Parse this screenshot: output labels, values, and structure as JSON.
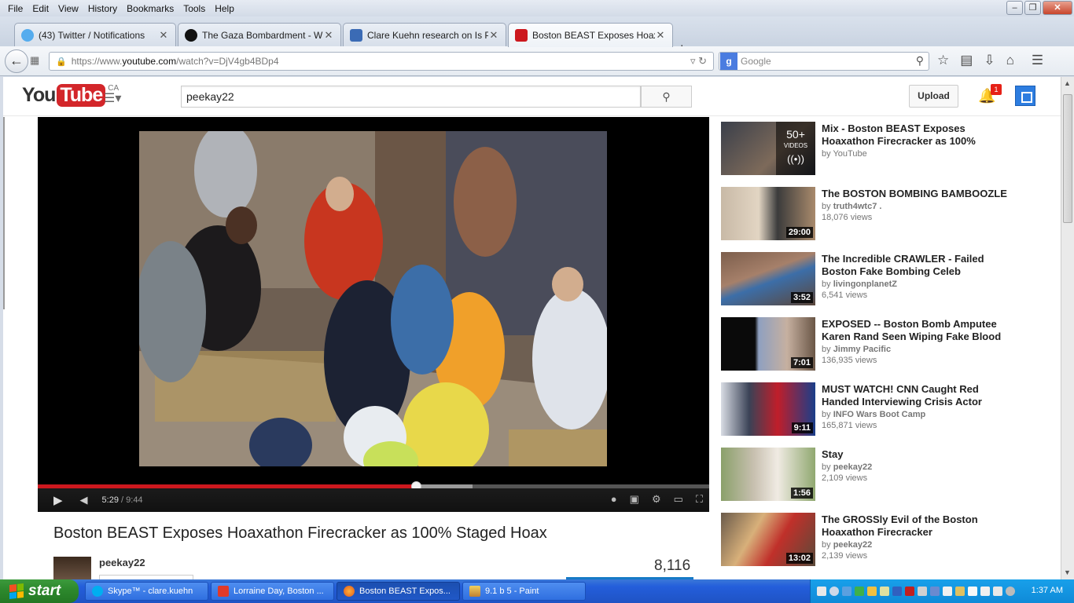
{
  "menubar": {
    "items": [
      "File",
      "Edit",
      "View",
      "History",
      "Bookmarks",
      "Tools",
      "Help"
    ]
  },
  "tabs": [
    {
      "title": "(43) Twitter / Notifications",
      "icon": "twitter-icon",
      "color": "#55acee"
    },
    {
      "title": "The Gaza Bombardment - Wh...",
      "icon": "site-icon",
      "color": "#111111"
    },
    {
      "title": "Clare Kuehn research on Is P...",
      "icon": "pb-icon",
      "color": "#3b6bb5"
    },
    {
      "title": "Boston BEAST Exposes Hoax...",
      "icon": "youtube-icon",
      "color": "#cc181e"
    }
  ],
  "navbar": {
    "url_prefix": "https://www.",
    "url_host": "youtube.com",
    "url_path": "/watch?v=DjV4gb4BDp4",
    "search_placeholder": "Google"
  },
  "youtube": {
    "logo_you": "You",
    "logo_tube": "Tube",
    "region": "CA",
    "search_value": "peekay22",
    "upload_label": "Upload",
    "notification_count": "1"
  },
  "player": {
    "current_time": "5:29",
    "separator": " / ",
    "duration": "9:44",
    "played_fraction": 0.563,
    "buffered_fraction": 0.647
  },
  "video": {
    "title": "Boston BEAST Exposes Hoaxathon Firecracker as 100% Staged Hoax",
    "uploader": "peekay22",
    "view_count": "8,116"
  },
  "recommendations": [
    {
      "title": "Mix - Boston BEAST Exposes Hoaxathon Firecracker as 100%",
      "by_prefix": "by ",
      "channel": "YouTube",
      "views": "",
      "duration": "",
      "mix_count": "50+",
      "mix_label": "VIDEOS"
    },
    {
      "title": "The BOSTON BOMBING BAMBOOZLE",
      "by_prefix": "by ",
      "channel": "truth4wtc7 .",
      "views": "18,076 views",
      "duration": "29:00"
    },
    {
      "title": "The Incredible CRAWLER - Failed Boston Fake Bombing Celeb",
      "by_prefix": "by ",
      "channel": "livingonplanetZ",
      "views": "6,541 views",
      "duration": "3:52"
    },
    {
      "title": "EXPOSED -- Boston Bomb Amputee Karen Rand Seen Wiping Fake Blood",
      "by_prefix": "by ",
      "channel": "Jimmy Pacific",
      "views": "136,935 views",
      "duration": "7:01"
    },
    {
      "title": "MUST WATCH! CNN Caught Red Handed Interviewing Crisis Actor",
      "by_prefix": "by ",
      "channel": "INFO Wars Boot Camp",
      "views": "165,871 views",
      "duration": "9:11"
    },
    {
      "title": "Stay",
      "by_prefix": "by ",
      "channel": "peekay22",
      "views": "2,109 views",
      "duration": "1:56"
    },
    {
      "title": "The GROSSly Evil of the Boston Hoaxathon Firecracker",
      "by_prefix": "by ",
      "channel": "peekay22",
      "views": "2,139 views",
      "duration": "13:02"
    }
  ],
  "taskbar": {
    "start_label": "start",
    "tasks": [
      {
        "label": "Skype™ - clare.kuehn",
        "icon": "skype-icon"
      },
      {
        "label": "Lorraine Day, Boston ...",
        "icon": "pdf-icon"
      },
      {
        "label": "Boston BEAST Expos...",
        "icon": "firefox-icon"
      },
      {
        "label": "9.1 b 5 - Paint",
        "icon": "paint-icon"
      }
    ],
    "clock": "1:37 AM"
  },
  "colors": {
    "youtube_red": "#cc181e",
    "link_blue": "#167ac6",
    "xp_blue": "#245edb",
    "start_green": "#2e8a2e"
  }
}
